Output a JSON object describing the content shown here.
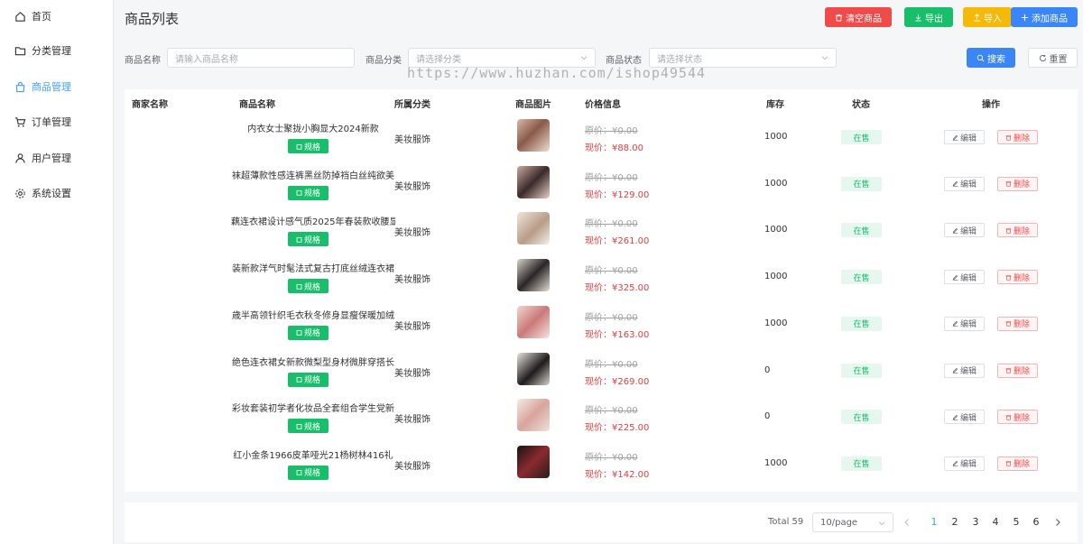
{
  "sidebar": {
    "items": [
      {
        "label": "首页",
        "icon": "home-icon"
      },
      {
        "label": "分类管理",
        "icon": "folder-icon"
      },
      {
        "label": "商品管理",
        "icon": "bag-icon",
        "active": true
      },
      {
        "label": "订单管理",
        "icon": "cart-icon"
      },
      {
        "label": "用户管理",
        "icon": "user-icon"
      },
      {
        "label": "系统设置",
        "icon": "gear-icon"
      }
    ]
  },
  "header": {
    "title": "商品列表",
    "buttons": {
      "clear": "清空商品",
      "export": "导出",
      "import": "导入",
      "add": "添加商品"
    }
  },
  "filters": {
    "name_label": "商品名称",
    "name_placeholder": "请输入商品名称",
    "category_label": "商品分类",
    "category_placeholder": "请选择分类",
    "status_label": "商品状态",
    "status_placeholder": "请选择状态",
    "search": "搜索",
    "reset": "重置"
  },
  "watermark": "https://www.huzhan.com/ishop49544",
  "table": {
    "columns": [
      "商家名称",
      "商品名称",
      "所属分类",
      "商品图片",
      "价格信息",
      "库存",
      "状态",
      "操作"
    ],
    "spec_label": "规格",
    "edit_label": "编辑",
    "delete_label": "删除",
    "orig_prefix": "原价：",
    "now_prefix": "现价：",
    "rows": [
      {
        "merchant": "",
        "name": "内衣女士聚拢小胸显大2024新款",
        "category": "美妆服饰",
        "orig_price": "¥0.00",
        "price": "¥88.00",
        "stock": "1000",
        "status": "在售"
      },
      {
        "merchant": "",
        "name": "袜超薄款性感连裤黑丝防掉裆白丝纯欲美",
        "category": "美妆服饰",
        "orig_price": "¥0.00",
        "price": "¥129.00",
        "stock": "1000",
        "status": "在售"
      },
      {
        "merchant": "",
        "name": "藕连衣裙设计感气质2025年春装款收腰显",
        "category": "美妆服饰",
        "orig_price": "¥0.00",
        "price": "¥261.00",
        "stock": "1000",
        "status": "在售"
      },
      {
        "merchant": "",
        "name": "装新款洋气时髦法式复古打底丝绒连衣裙",
        "category": "美妆服饰",
        "orig_price": "¥0.00",
        "price": "¥325.00",
        "stock": "1000",
        "status": "在售"
      },
      {
        "merchant": "",
        "name": "歳半高领针织毛衣秋冬修身显瘦保暖加绒",
        "category": "美妆服饰",
        "orig_price": "¥0.00",
        "price": "¥163.00",
        "stock": "1000",
        "status": "在售"
      },
      {
        "merchant": "",
        "name": "绝色连衣裙女新款微梨型身材微胖穿搭长",
        "category": "美妆服饰",
        "orig_price": "¥0.00",
        "price": "¥269.00",
        "stock": "0",
        "status": "在售"
      },
      {
        "merchant": "",
        "name": "彩妆套装初学者化妆品全套组合学生党新",
        "category": "美妆服饰",
        "orig_price": "¥0.00",
        "price": "¥225.00",
        "stock": "0",
        "status": "在售"
      },
      {
        "merchant": "",
        "name": "红小金条1966皮革哑光21杨树林416礼",
        "category": "美妆服饰",
        "orig_price": "¥0.00",
        "price": "¥142.00",
        "stock": "1000",
        "status": "在售"
      }
    ]
  },
  "pagination": {
    "total": "Total 59",
    "page_size": "10/page",
    "pages": [
      "1",
      "2",
      "3",
      "4",
      "5",
      "6"
    ],
    "current": "1"
  },
  "colors": {
    "accent": "#409eff",
    "danger": "#f04b4b",
    "success": "#19be6b",
    "warning": "#f5b90a",
    "primary_btn": "#3b86f7"
  }
}
